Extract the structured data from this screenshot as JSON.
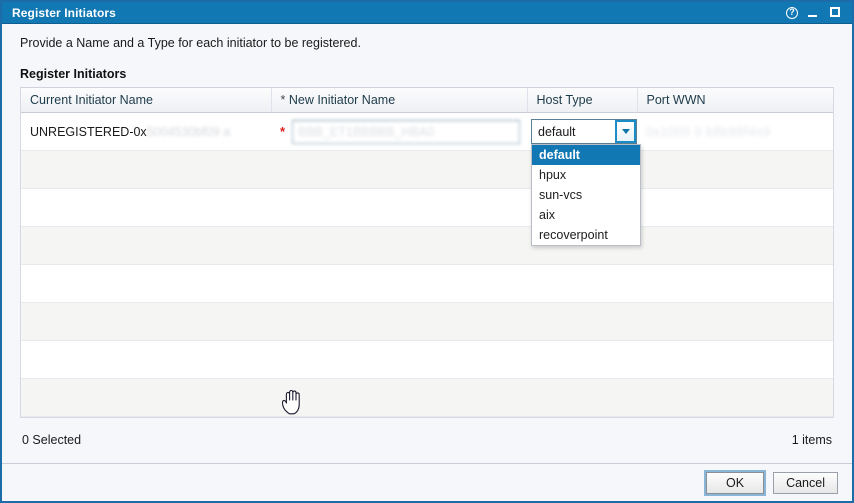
{
  "window": {
    "title": "Register Initiators",
    "controls": [
      {
        "name": "help-icon",
        "glyph": "?"
      },
      {
        "name": "minimize-icon",
        "glyph": "_"
      },
      {
        "name": "maximize-icon",
        "glyph": "□"
      }
    ]
  },
  "intro": {
    "text": "Provide a Name and a Type for each initiator to be registered."
  },
  "section": {
    "title": "Register Initiators"
  },
  "table": {
    "columns": [
      {
        "label": "Current Initiator Name",
        "required_marker": ""
      },
      {
        "label": "New Initiator Name",
        "required_marker": "*"
      },
      {
        "label": "Host Type",
        "required_marker": ""
      },
      {
        "label": "Port WWN",
        "required_marker": ""
      }
    ],
    "rows": [
      {
        "current_initiator_name": "UNREGISTERED-0x",
        "current_initiator_name_redacted": "5004530bf09 a",
        "new_initiator_name_value": "",
        "new_initiator_name_redacted": "BBB_ET1BBBBB_HBA0",
        "required_marker": "*",
        "host_type": "default",
        "port_wwn_redacted": "0x1000    0 b8b99f4n9"
      },
      {
        "empty": true
      },
      {
        "empty": true
      },
      {
        "empty": true
      },
      {
        "empty": true
      },
      {
        "empty": true
      },
      {
        "empty": true
      },
      {
        "empty": true
      }
    ]
  },
  "host_type_select": {
    "value": "default",
    "expanded": true,
    "options": [
      {
        "label": "default",
        "selected": true
      },
      {
        "label": "hpux",
        "selected": false
      },
      {
        "label": "sun-vcs",
        "selected": false
      },
      {
        "label": "aix",
        "selected": false
      },
      {
        "label": "recoverpoint",
        "selected": false
      }
    ]
  },
  "status": {
    "selected_text": "0 Selected",
    "items_text": "1 items"
  },
  "footer": {
    "ok_label": "OK",
    "cancel_label": "Cancel"
  },
  "cursor": {
    "name": "grab-hand-cursor"
  },
  "colors": {
    "titlebar": "#1278b4",
    "dialog_border": "#1b6ca8",
    "background": "#f6f7fb",
    "row_alt": "#f5f5f3",
    "selected_option": "#1278b4",
    "required_asterisk": "#e02020"
  }
}
